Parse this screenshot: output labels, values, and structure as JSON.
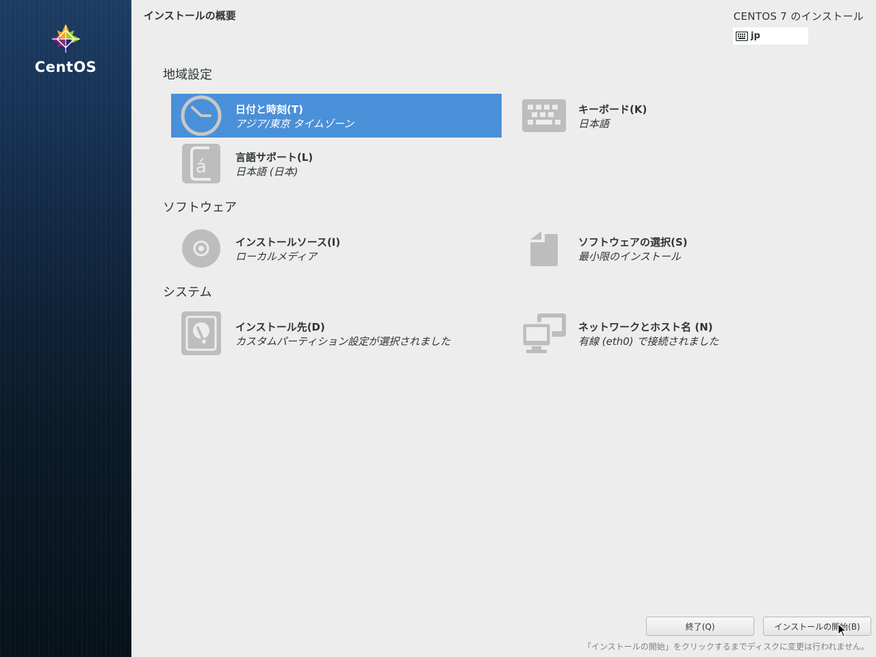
{
  "sidebar": {
    "logo_text": "CentOS"
  },
  "header": {
    "page_title": "インストールの概要",
    "product_title": "CENTOS 7 のインストール",
    "keyboard_layout": "jp"
  },
  "sections": {
    "localization": {
      "heading": "地域設定",
      "date_time": {
        "title": "日付と時刻(T)",
        "status": "アジア/東京 タイムゾーン"
      },
      "keyboard": {
        "title": "キーボード(K)",
        "status": "日本語"
      },
      "language": {
        "title": "言語サポート(L)",
        "status": "日本語 (日本)"
      }
    },
    "software": {
      "heading": "ソフトウェア",
      "install_source": {
        "title": "インストールソース(I)",
        "status": "ローカルメディア"
      },
      "software_selection": {
        "title": "ソフトウェアの選択(S)",
        "status": "最小限のインストール"
      }
    },
    "system": {
      "heading": "システム",
      "install_destination": {
        "title": "インストール先(D)",
        "status": "カスタムパーティション設定が選択されました"
      },
      "network": {
        "title": "ネットワークとホスト名 (N)",
        "status": "有線 (eth0) で接続されました"
      }
    }
  },
  "footer": {
    "quit_label": "終了(Q)",
    "begin_label": "インストールの開始(B)",
    "note": "「インストールの開始」をクリックするまでディスクに変更は行われません。"
  },
  "colors": {
    "selected_spoke": "#4a90d9",
    "icon_gray": "#bdbdbd",
    "background": "#ededed"
  },
  "icons": {
    "date_time": "clock-icon",
    "keyboard": "keyboard-icon",
    "language": "language-icon",
    "install_source": "disc-icon",
    "software_selection": "package-icon",
    "install_destination": "harddisk-icon",
    "network": "network-icon"
  }
}
